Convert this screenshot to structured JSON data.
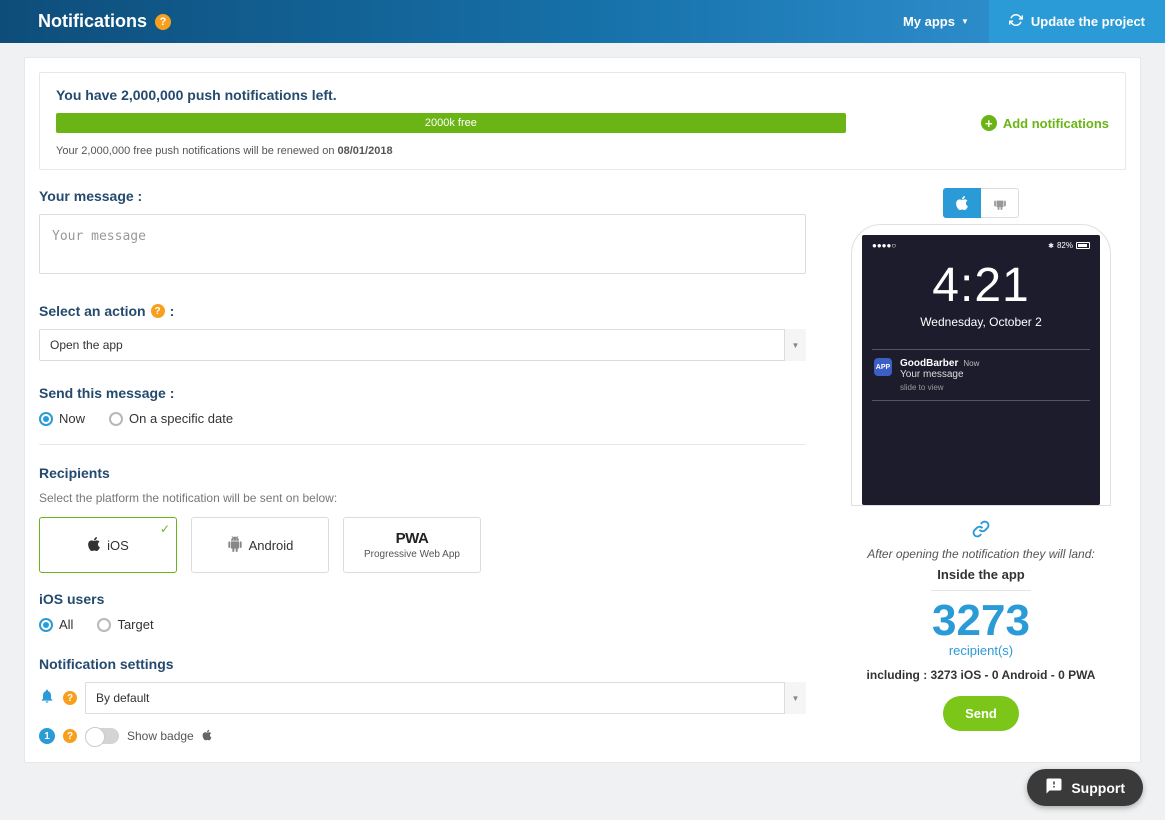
{
  "header": {
    "title": "Notifications",
    "my_apps": "My apps",
    "update": "Update the project"
  },
  "quota": {
    "title": "You have 2,000,000 push notifications left.",
    "bar_label": "2000k free",
    "renew_prefix": "Your 2,000,000 free push notifications will be renewed on ",
    "renew_date": "08/01/2018",
    "add_label": "Add notifications"
  },
  "message": {
    "label": "Your message :",
    "placeholder": "Your message"
  },
  "action": {
    "label": "Select an action",
    "value": "Open the app"
  },
  "send": {
    "label": "Send this message :",
    "now": "Now",
    "specific": "On a specific date"
  },
  "recipients": {
    "label": "Recipients",
    "hint": "Select the platform the notification will be sent on below:",
    "ios": "iOS",
    "android": "Android",
    "pwa_sub": "Progressive Web App"
  },
  "ios_users": {
    "label": "iOS users",
    "all": "All",
    "target": "Target"
  },
  "settings": {
    "label": "Notification settings",
    "default": "By default",
    "show_badge": "Show badge",
    "badge_num": "1"
  },
  "preview": {
    "battery": "82%",
    "time": "4:21",
    "date": "Wednesday, October 2",
    "app": "GoodBarber",
    "now": "Now",
    "msg": "Your message",
    "slide": "slide to view",
    "land_txt": "After opening the notification they will land:",
    "land_val": "Inside the app",
    "count": "3273",
    "count_label": "recipient(s)",
    "breakdown": "including : 3273 iOS - 0 Android - 0 PWA",
    "send_btn": "Send"
  },
  "support": "Support"
}
